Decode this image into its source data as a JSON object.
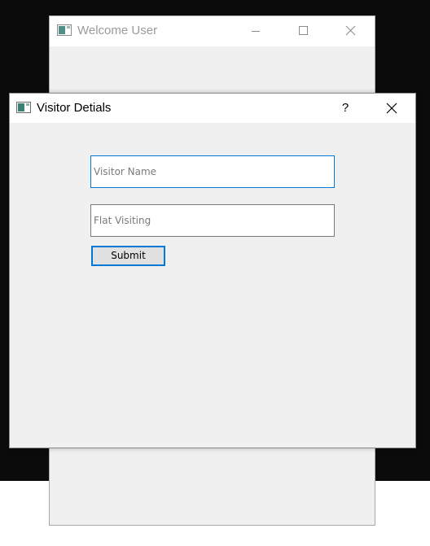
{
  "background_window": {
    "title": "Welcome User",
    "buttons": {
      "minimize_icon": "minimize-icon",
      "maximize_icon": "maximize-icon",
      "close_icon": "close-icon"
    }
  },
  "dialog": {
    "title": "Visitor Detials",
    "help_label": "?",
    "close_icon": "close-icon",
    "fields": {
      "visitor_name": {
        "value": "",
        "placeholder": "Visitor Name",
        "focused": true
      },
      "flat_visiting": {
        "value": "",
        "placeholder": "Flat Visiting",
        "focused": false
      }
    },
    "submit_label": "Submit"
  },
  "colors": {
    "focus_accent": "#0078d7",
    "dialog_background": "#f0f0f0",
    "titlebar_background": "#ffffff",
    "inactive_title_text": "#9a9a9a",
    "desktop": "#0b0b0b"
  }
}
